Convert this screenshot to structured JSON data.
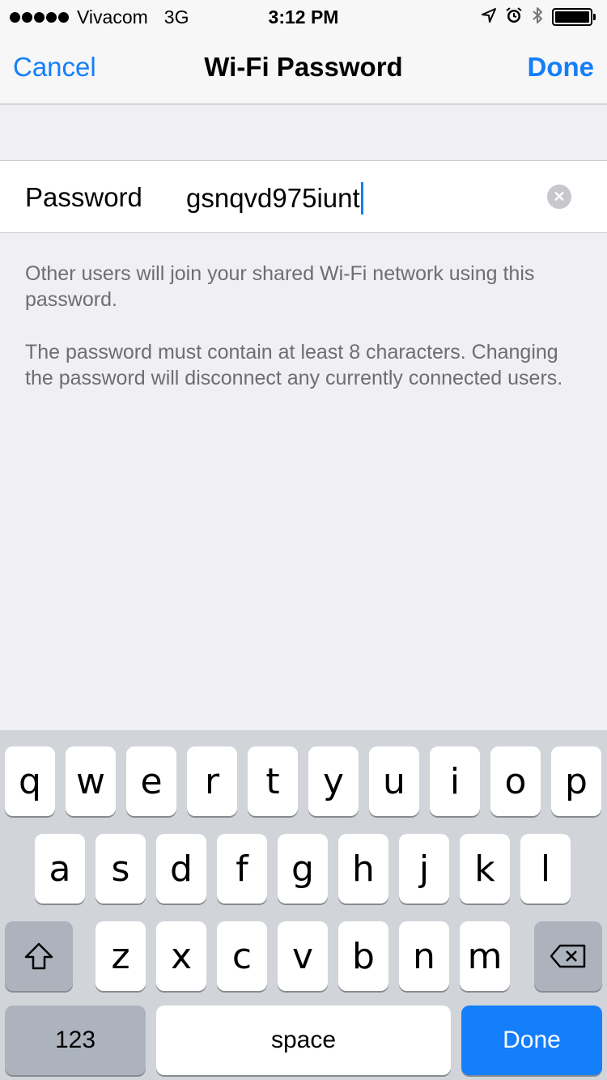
{
  "status_bar": {
    "carrier": "Vivacom",
    "network": "3G",
    "time": "3:12 PM",
    "icons": [
      "location-arrow-icon",
      "alarm-icon",
      "bluetooth-icon",
      "battery-icon"
    ],
    "battery_level": 1.0
  },
  "nav": {
    "cancel_label": "Cancel",
    "title": "Wi-Fi Password",
    "done_label": "Done",
    "accent_color": "#147efb"
  },
  "password_field": {
    "label": "Password",
    "value": "gsnqvd975iunt",
    "clear_icon": "clear-circle-icon"
  },
  "footnotes": {
    "line1": "Other users will join your shared Wi-Fi network using this password.",
    "line2": "The password must contain at least 8 characters. Changing the password will disconnect any currently connected users."
  },
  "keyboard": {
    "row1": [
      "q",
      "w",
      "e",
      "r",
      "t",
      "y",
      "u",
      "i",
      "o",
      "p"
    ],
    "row2": [
      "a",
      "s",
      "d",
      "f",
      "g",
      "h",
      "j",
      "k",
      "l"
    ],
    "row3": [
      "z",
      "x",
      "c",
      "v",
      "b",
      "n",
      "m"
    ],
    "shift_icon": "shift-icon",
    "delete_icon": "backspace-icon",
    "numbers_label": "123",
    "space_label": "space",
    "return_label": "Done"
  }
}
